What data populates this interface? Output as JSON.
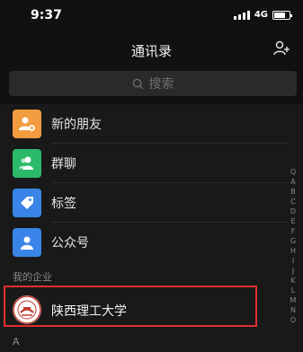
{
  "status": {
    "time": "9:37",
    "network": "4G"
  },
  "nav": {
    "title": "通讯录"
  },
  "search": {
    "placeholder": "搜索"
  },
  "menu": [
    {
      "label": "新的朋友",
      "icon": "add-friend-icon",
      "color": "#f39c3f"
    },
    {
      "label": "群聊",
      "icon": "group-chat-icon",
      "color": "#2bb96a"
    },
    {
      "label": "标签",
      "icon": "tag-icon",
      "color": "#3a84e8"
    },
    {
      "label": "公众号",
      "icon": "official-account-icon",
      "color": "#3a84e8"
    }
  ],
  "enterprise": {
    "header": "我的企业",
    "org_name": "陕西理工大学"
  },
  "contacts": {
    "section": "A"
  },
  "index_letters": [
    "Q",
    "A",
    "B",
    "C",
    "D",
    "E",
    "F",
    "G",
    "H",
    "I",
    "J",
    "K",
    "L",
    "M",
    "N",
    "O"
  ],
  "colors": {
    "highlight": "#e03030",
    "background": "#191919"
  }
}
